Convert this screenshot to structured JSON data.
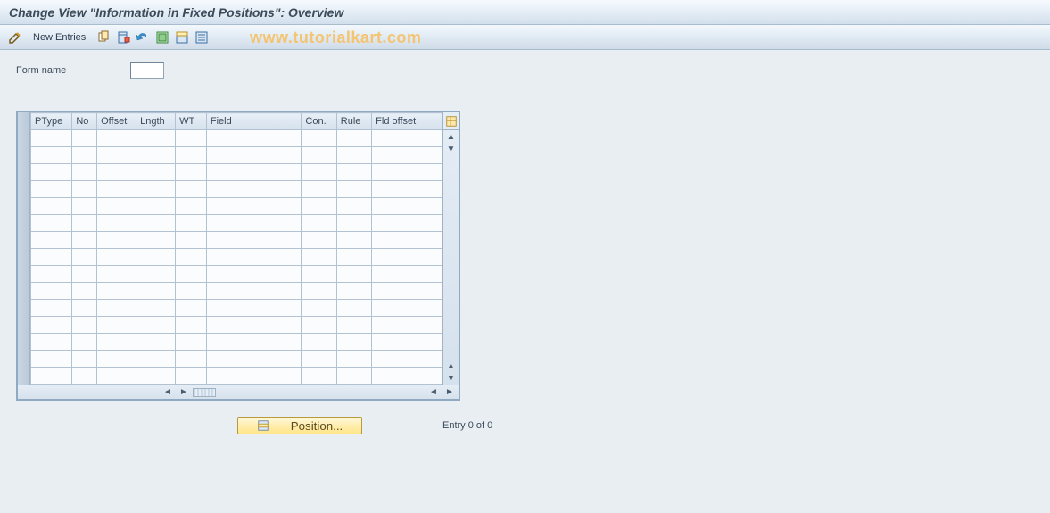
{
  "title": "Change View \"Information in Fixed Positions\": Overview",
  "toolbar": {
    "new_entries_label": "New Entries"
  },
  "watermark": "www.tutorialkart.com",
  "form": {
    "form_name_label": "Form name",
    "form_name_value": ""
  },
  "grid": {
    "columns": [
      {
        "key": "ptype",
        "label": "PType",
        "width": 40
      },
      {
        "key": "no",
        "label": "No",
        "width": 24
      },
      {
        "key": "offset",
        "label": "Offset",
        "width": 38
      },
      {
        "key": "lngth",
        "label": "Lngth",
        "width": 38
      },
      {
        "key": "wt",
        "label": "WT",
        "width": 30
      },
      {
        "key": "field",
        "label": "Field",
        "width": 92
      },
      {
        "key": "con",
        "label": "Con.",
        "width": 34
      },
      {
        "key": "rule",
        "label": "Rule",
        "width": 34
      },
      {
        "key": "fld_offset",
        "label": "Fld offset",
        "width": 68
      }
    ],
    "rows": [
      {},
      {},
      {},
      {},
      {},
      {},
      {},
      {},
      {},
      {},
      {},
      {},
      {},
      {},
      {}
    ]
  },
  "footer": {
    "position_label": "Position...",
    "entry_count_label": "Entry 0 of 0"
  }
}
